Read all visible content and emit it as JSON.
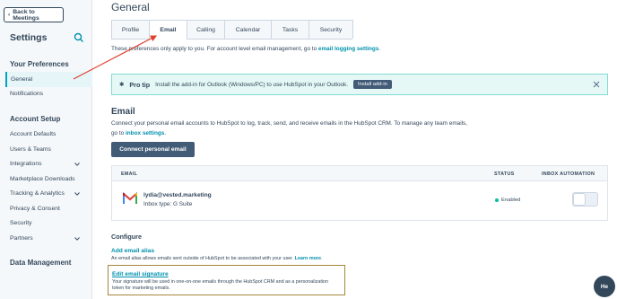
{
  "sidebar": {
    "back_label": "Back to Meetings",
    "title": "Settings",
    "your_preferences": "Your Preferences",
    "general": "General",
    "notifications": "Notifications",
    "account_setup": "Account Setup",
    "items": [
      "Account Defaults",
      "Users & Teams",
      "Integrations",
      "Marketplace Downloads",
      "Tracking & Analytics",
      "Privacy & Consent",
      "Security",
      "Partners"
    ],
    "data_management": "Data Management"
  },
  "main": {
    "title": "General",
    "tabs": [
      "Profile",
      "Email",
      "Calling",
      "Calendar",
      "Tasks",
      "Security"
    ],
    "active_tab": "Email",
    "intro_text": "These preferences only apply to you. For account level email management, go to ",
    "intro_link": "email logging settings",
    "intro_end": ".",
    "tip_title": "Pro tip",
    "tip_text": "Install the add-in for Outlook (Windows/PC) to use HubSpot in your Outlook.",
    "tip_button": "Install add-in",
    "email_heading": "Email",
    "email_desc": "Connect your personal email accounts to HubSpot to log, track, send, and receive emails in the HubSpot CRM. To manage any team emails, go to ",
    "email_desc_link": "inbox settings",
    "email_desc_end": ".",
    "connect_button": "Connect personal email",
    "table_headers": {
      "email": "EMAIL",
      "status": "STATUS",
      "inbox": "INBOX AUTOMATION"
    },
    "account_email": "lydia@vested.marketing",
    "account_type": "Inbox type: G Suite",
    "account_status": "Enabled",
    "configure_heading": "Configure",
    "alias_link": "Add email alias",
    "alias_desc": "An email alias allows emails sent outside of HubSpot to be associated with your user. ",
    "alias_learn": "Learn more",
    "alias_end": ".",
    "signature_link": "Edit email signature",
    "signature_desc": "Your signature will be used in one-on-one emails through the HubSpot CRM and as a personalization token for marketing emails.",
    "help_label": "He"
  },
  "colors": {
    "accent": "#00a4bd",
    "link": "#0091ae",
    "primary_button": "#425b76",
    "annotation_arrow": "#e03e2d",
    "highlight_box": "#a7863a"
  }
}
